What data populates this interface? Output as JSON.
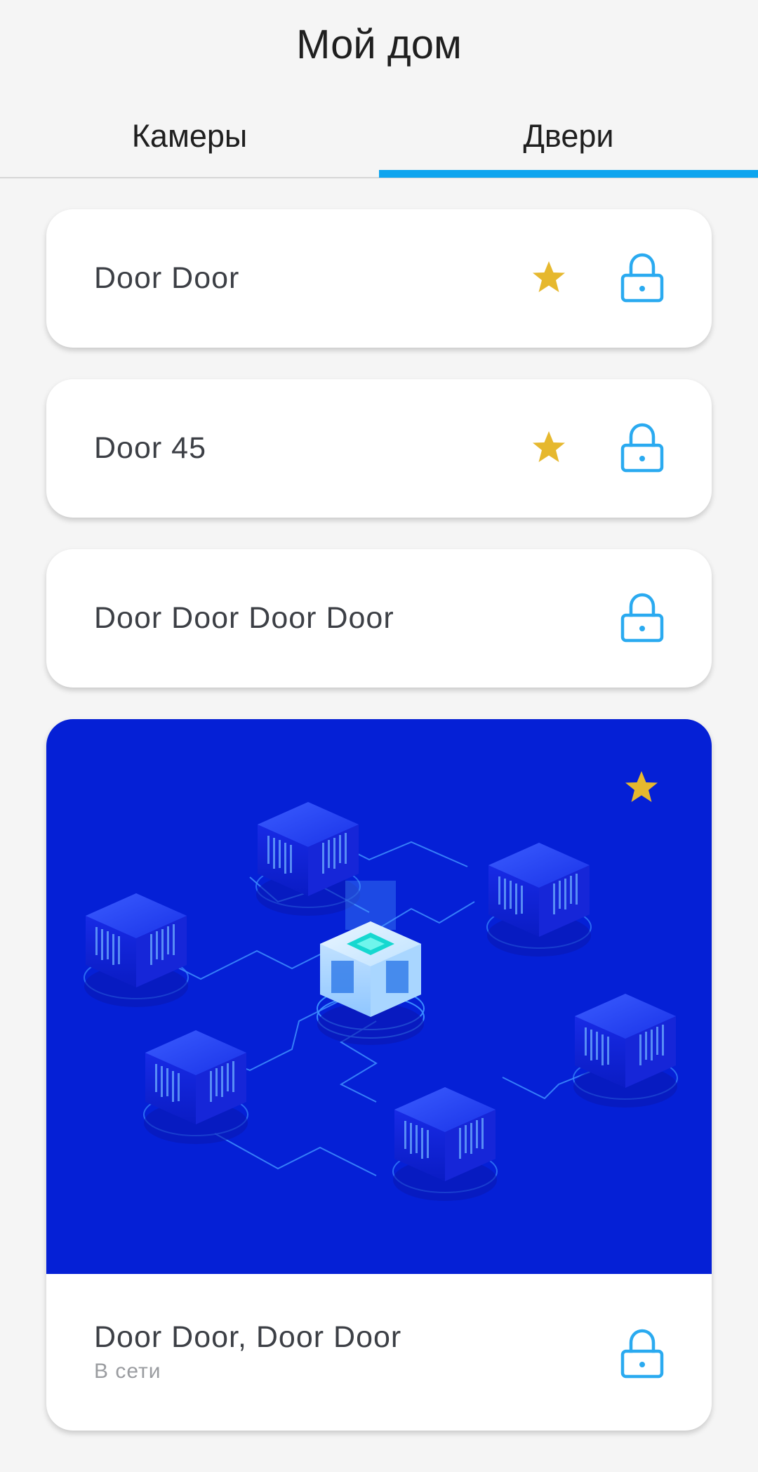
{
  "header": {
    "title": "Мой дом"
  },
  "tabs": [
    {
      "label": "Камеры",
      "active": false
    },
    {
      "label": "Двери",
      "active": true
    }
  ],
  "colors": {
    "accent": "#0ea5ef",
    "star": "#e6b82e",
    "lock": "#2aaaf0",
    "preview_background": "#0520d6"
  },
  "doors": [
    {
      "name": "Door Door",
      "favorite": true,
      "icon": "lock-icon"
    },
    {
      "name": "Door 45",
      "favorite": true,
      "icon": "lock-icon"
    },
    {
      "name": "Door Door Door Door",
      "favorite": false,
      "icon": "lock-icon"
    }
  ],
  "camera_door": {
    "name": "Door Door, Door Door",
    "status": "В сети",
    "favorite": true,
    "icon": "lock-icon",
    "preview": "isometric-server-network-illustration"
  }
}
